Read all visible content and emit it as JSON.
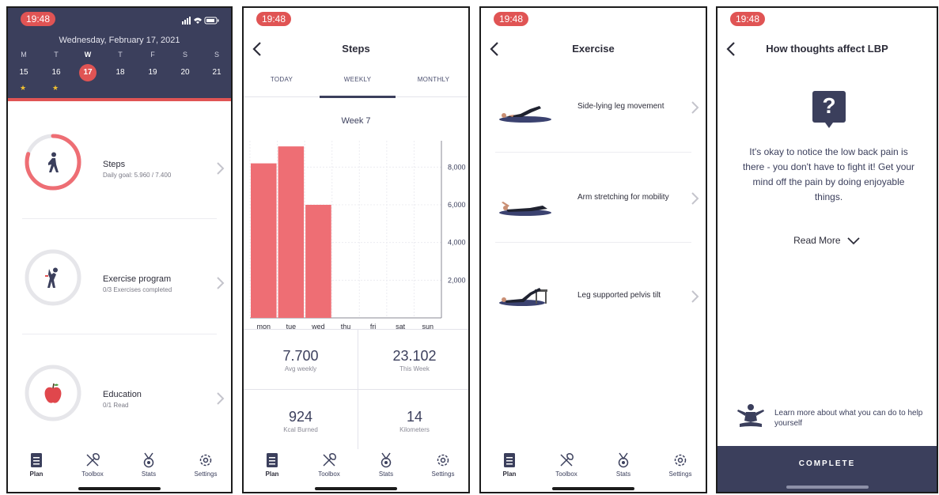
{
  "status": {
    "time": "19:48"
  },
  "plan_screen": {
    "calendar": {
      "date_label": "Wednesday, February 17, 2021",
      "weekdays": [
        "M",
        "T",
        "W",
        "T",
        "F",
        "S",
        "S"
      ],
      "days": [
        "15",
        "16",
        "17",
        "18",
        "19",
        "20",
        "21"
      ],
      "selected_index": 2,
      "star_glyph": "★",
      "starred_days": [
        "15",
        "16"
      ]
    },
    "items": [
      {
        "title": "Steps",
        "subtitle": "Daily goal: 5.960 / 7.400",
        "icon": "walking-person-icon",
        "progress": 0.8
      },
      {
        "title": "Exercise program",
        "subtitle": "0/3 Exercises completed",
        "icon": "stretching-person-icon",
        "progress": 0
      },
      {
        "title": "Education",
        "subtitle": "0/1 Read",
        "icon": "apple-icon",
        "progress": 0
      }
    ]
  },
  "tabs": [
    {
      "label": "Plan",
      "icon": "clipboard-icon"
    },
    {
      "label": "Toolbox",
      "icon": "wrench-screwdriver-icon"
    },
    {
      "label": "Stats",
      "icon": "medal-icon"
    },
    {
      "label": "Settings",
      "icon": "gear-icon"
    }
  ],
  "steps_screen": {
    "title": "Steps",
    "segments": [
      "TODAY",
      "WEEKLY",
      "MONTHLY"
    ],
    "active_segment": "WEEKLY",
    "week_label": "Week 7",
    "stats": [
      {
        "value": "7.700",
        "label": "Avg weekly"
      },
      {
        "value": "23.102",
        "label": "This Week"
      },
      {
        "value": "924",
        "label": "Kcal Burned"
      },
      {
        "value": "14",
        "label": "Kilometers"
      }
    ]
  },
  "chart_data": {
    "type": "bar",
    "categories": [
      "mon",
      "tue",
      "wed",
      "thu",
      "fri",
      "sat",
      "sun"
    ],
    "values": [
      8200,
      9100,
      6000,
      0,
      0,
      0,
      0
    ],
    "yticks": [
      "2,000",
      "4,000",
      "6,000",
      "8,000"
    ],
    "ytick_values": [
      2000,
      4000,
      6000,
      8000
    ],
    "ylim": [
      0,
      9400
    ],
    "ylabel": "",
    "xlabel": "",
    "bar_color": "#ee6e74",
    "grid": true
  },
  "exercise_screen": {
    "title": "Exercise",
    "items": [
      {
        "title": "Side-lying leg movement"
      },
      {
        "title": "Arm stretching for mobility"
      },
      {
        "title": "Leg supported pelvis tilt"
      }
    ]
  },
  "lbp_screen": {
    "title": "How thoughts affect LBP",
    "question_mark": "?",
    "body": "It's okay to notice the low back pain is there - you don't have to fight it! Get your mind off the pain by doing enjoyable things.",
    "read_more": "Read More",
    "learn_more": "Learn more about what you can do to help yourself",
    "complete_label": "COMPLETE"
  },
  "colors": {
    "accent": "#e05454",
    "navy": "#3b3f5c",
    "bar": "#ee6e74"
  }
}
